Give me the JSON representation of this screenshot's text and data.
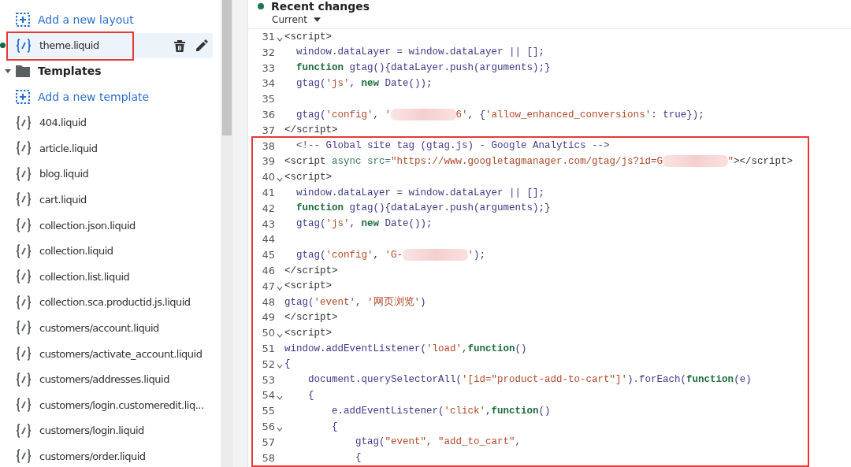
{
  "sidebar": {
    "items": [
      {
        "kind": "add",
        "label": "Add a new layout"
      },
      {
        "kind": "file",
        "label": "theme.liquid",
        "selected": true,
        "changed": true,
        "annotated": true
      },
      {
        "kind": "folder",
        "label": "Templates",
        "expanded": true,
        "children": [
          {
            "kind": "add",
            "label": "Add a new template"
          },
          {
            "kind": "file",
            "label": "404.liquid",
            "selected": false,
            "changed": false,
            "annotated": false
          },
          {
            "kind": "file",
            "label": "article.liquid",
            "selected": false,
            "changed": false,
            "annotated": false
          },
          {
            "kind": "file",
            "label": "blog.liquid",
            "selected": false,
            "changed": false,
            "annotated": false
          },
          {
            "kind": "file",
            "label": "cart.liquid",
            "selected": false,
            "changed": false,
            "annotated": false
          },
          {
            "kind": "file",
            "label": "collection.json.liquid",
            "selected": false,
            "changed": false,
            "annotated": false
          },
          {
            "kind": "file",
            "label": "collection.liquid",
            "selected": false,
            "changed": false,
            "annotated": false
          },
          {
            "kind": "file",
            "label": "collection.list.liquid",
            "selected": false,
            "changed": false,
            "annotated": false
          },
          {
            "kind": "file",
            "label": "collection.sca.productid.js.liquid",
            "selected": false,
            "changed": false,
            "annotated": false
          },
          {
            "kind": "file",
            "label": "customers/account.liquid",
            "selected": false,
            "changed": false,
            "annotated": false
          },
          {
            "kind": "file",
            "label": "customers/activate_account.liquid",
            "selected": false,
            "changed": false,
            "annotated": false
          },
          {
            "kind": "file",
            "label": "customers/addresses.liquid",
            "selected": false,
            "changed": false,
            "annotated": false
          },
          {
            "kind": "file",
            "label": "customers/login.customeredit.liq...",
            "selected": false,
            "changed": false,
            "annotated": false
          },
          {
            "kind": "file",
            "label": "customers/login.liquid",
            "selected": false,
            "changed": false,
            "annotated": false
          },
          {
            "kind": "file",
            "label": "customers/order.liquid",
            "selected": false,
            "changed": false,
            "annotated": false
          }
        ]
      }
    ]
  },
  "editor": {
    "title": "Recent changes",
    "version": "Current",
    "blocks": [
      {
        "annotated": false,
        "lines": [
          {
            "number": "31",
            "foldable": true,
            "segments": [
              {
                "kind": "tag",
                "text": "<script>"
              }
            ]
          },
          {
            "number": "32",
            "foldable": false,
            "segments": [
              {
                "kind": "plain",
                "text": "  window.dataLayer = window.dataLayer || [];"
              }
            ]
          },
          {
            "number": "33",
            "foldable": false,
            "segments": [
              {
                "kind": "keyword",
                "text": "  function"
              },
              {
                "kind": "plain",
                "text": " gtag(){dataLayer.push(arguments);}"
              }
            ]
          },
          {
            "number": "34",
            "foldable": false,
            "segments": [
              {
                "kind": "plain",
                "text": "  gtag("
              },
              {
                "kind": "string",
                "text": "'js'"
              },
              {
                "kind": "plain",
                "text": ", "
              },
              {
                "kind": "keyword",
                "text": "new"
              },
              {
                "kind": "plain",
                "text": " Date());"
              }
            ]
          },
          {
            "number": "35",
            "foldable": false
          },
          {
            "number": "36",
            "foldable": false,
            "segments": [
              {
                "kind": "plain",
                "text": "  gtag("
              },
              {
                "kind": "string",
                "text": "'config'"
              },
              {
                "kind": "plain",
                "text": ", "
              },
              {
                "kind": "string",
                "text": "'"
              },
              {
                "kind": "redacted"
              },
              {
                "kind": "string",
                "text": "6'"
              },
              {
                "kind": "plain",
                "text": ", {"
              },
              {
                "kind": "string",
                "text": "'allow_enhanced_conversions'"
              },
              {
                "kind": "plain",
                "text": ": true});"
              }
            ]
          },
          {
            "number": "37",
            "foldable": false,
            "segments": [
              {
                "kind": "tag",
                "text": "</script>"
              }
            ]
          }
        ]
      },
      {
        "annotated": true,
        "lines": [
          {
            "number": "38",
            "foldable": false,
            "segments": [
              {
                "kind": "comment",
                "text": "  <!-- Global site tag (gtag.js) - Google Analytics -->"
              }
            ]
          },
          {
            "number": "39",
            "foldable": false,
            "segments": [
              {
                "kind": "tag",
                "text": "<script "
              },
              {
                "kind": "attr",
                "text": "async src="
              },
              {
                "kind": "string",
                "text": "\"https://www.googletagmanager.com/gtag/js?id=G"
              },
              {
                "kind": "redacted"
              },
              {
                "kind": "string",
                "text": "\""
              },
              {
                "kind": "tag",
                "text": "></script>"
              }
            ]
          },
          {
            "number": "40",
            "foldable": true,
            "segments": [
              {
                "kind": "tag",
                "text": "<script>"
              }
            ]
          },
          {
            "number": "41",
            "foldable": false,
            "segments": [
              {
                "kind": "plain",
                "text": "  window.dataLayer = window.dataLayer || [];"
              }
            ]
          },
          {
            "number": "42",
            "foldable": false,
            "segments": [
              {
                "kind": "keyword",
                "text": "  function"
              },
              {
                "kind": "plain",
                "text": " gtag(){dataLayer.push(arguments);}"
              }
            ]
          },
          {
            "number": "43",
            "foldable": false,
            "segments": [
              {
                "kind": "plain",
                "text": "  gtag("
              },
              {
                "kind": "string",
                "text": "'js'"
              },
              {
                "kind": "plain",
                "text": ", "
              },
              {
                "kind": "keyword",
                "text": "new"
              },
              {
                "kind": "plain",
                "text": " Date());"
              }
            ]
          },
          {
            "number": "44",
            "foldable": false
          },
          {
            "number": "45",
            "foldable": false,
            "segments": [
              {
                "kind": "plain",
                "text": "  gtag("
              },
              {
                "kind": "string",
                "text": "'config'"
              },
              {
                "kind": "plain",
                "text": ", "
              },
              {
                "kind": "string",
                "text": "'G-"
              },
              {
                "kind": "redacted"
              },
              {
                "kind": "string",
                "text": "'"
              },
              {
                "kind": "plain",
                "text": ");"
              }
            ]
          },
          {
            "number": "46",
            "foldable": false,
            "segments": [
              {
                "kind": "tag",
                "text": "</script>"
              }
            ]
          },
          {
            "number": "47",
            "foldable": true,
            "segments": [
              {
                "kind": "tag",
                "text": "<script>"
              }
            ]
          },
          {
            "number": "48",
            "foldable": false,
            "segments": [
              {
                "kind": "plain",
                "text": "gtag("
              },
              {
                "kind": "string",
                "text": "'event'"
              },
              {
                "kind": "plain",
                "text": ", "
              },
              {
                "kind": "string",
                "text": "'网页浏览'"
              },
              {
                "kind": "plain",
                "text": ")"
              }
            ]
          },
          {
            "number": "49",
            "foldable": false,
            "segments": [
              {
                "kind": "tag",
                "text": "</script>"
              }
            ]
          },
          {
            "number": "50",
            "foldable": true,
            "segments": [
              {
                "kind": "tag",
                "text": "<script>"
              }
            ]
          },
          {
            "number": "51",
            "foldable": false,
            "segments": [
              {
                "kind": "plain",
                "text": "window.addEventListener("
              },
              {
                "kind": "string",
                "text": "'load'"
              },
              {
                "kind": "plain",
                "text": ","
              },
              {
                "kind": "keyword",
                "text": "function"
              },
              {
                "kind": "plain",
                "text": "()"
              }
            ]
          },
          {
            "number": "52",
            "foldable": true,
            "segments": [
              {
                "kind": "plain",
                "text": "{"
              }
            ]
          },
          {
            "number": "53",
            "foldable": false,
            "segments": [
              {
                "kind": "plain",
                "text": "    document.querySelectorAll("
              },
              {
                "kind": "string",
                "text": "'[id=\"product-add-to-cart\"]'"
              },
              {
                "kind": "plain",
                "text": ").forEach("
              },
              {
                "kind": "keyword",
                "text": "function"
              },
              {
                "kind": "plain",
                "text": "(e)"
              }
            ]
          },
          {
            "number": "54",
            "foldable": true,
            "segments": [
              {
                "kind": "plain",
                "text": "    {"
              }
            ]
          },
          {
            "number": "55",
            "foldable": false,
            "segments": [
              {
                "kind": "plain",
                "text": "        e.addEventListener("
              },
              {
                "kind": "string",
                "text": "'click'"
              },
              {
                "kind": "plain",
                "text": ","
              },
              {
                "kind": "keyword",
                "text": "function"
              },
              {
                "kind": "plain",
                "text": "()"
              }
            ]
          },
          {
            "number": "56",
            "foldable": true,
            "segments": [
              {
                "kind": "plain",
                "text": "        {"
              }
            ]
          },
          {
            "number": "57",
            "foldable": false,
            "segments": [
              {
                "kind": "plain",
                "text": "            gtag("
              },
              {
                "kind": "string",
                "text": "\"event\""
              },
              {
                "kind": "plain",
                "text": ", "
              },
              {
                "kind": "string",
                "text": "\"add_to_cart\""
              },
              {
                "kind": "plain",
                "text": ","
              }
            ]
          },
          {
            "number": "58",
            "foldable": false,
            "segments": [
              {
                "kind": "plain",
                "text": "            {"
              }
            ]
          }
        ]
      }
    ]
  }
}
